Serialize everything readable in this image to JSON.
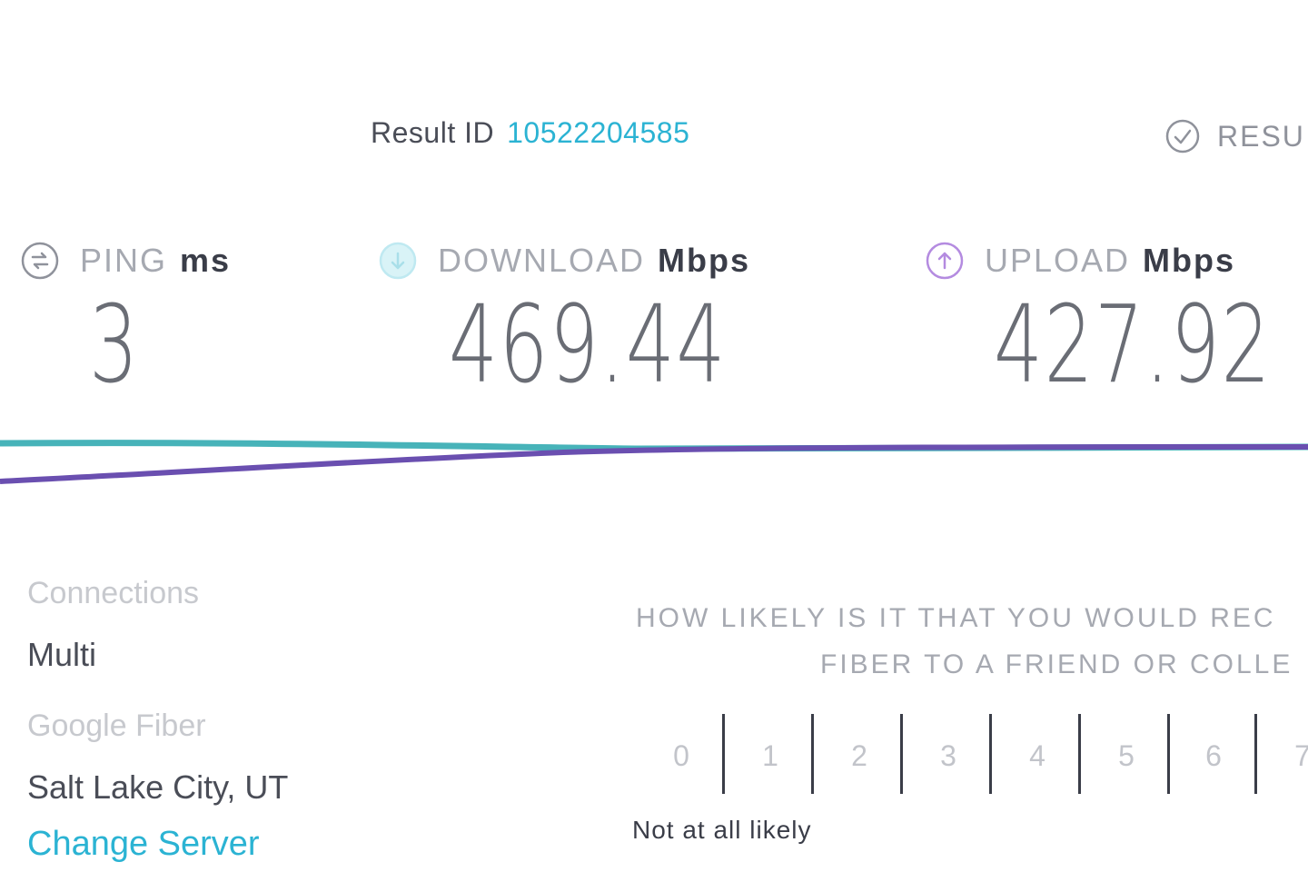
{
  "result": {
    "label": "Result ID",
    "id": "10522204585",
    "results_link": "RESU"
  },
  "metrics": {
    "ping": {
      "name": "PING",
      "unit": "ms",
      "value": "3"
    },
    "download": {
      "name": "DOWNLOAD",
      "unit": "Mbps",
      "value": "469.44"
    },
    "upload": {
      "name": "UPLOAD",
      "unit": "Mbps",
      "value": "427.92"
    }
  },
  "server": {
    "connections_label": "Connections",
    "connections_value": "Multi",
    "isp": "Google Fiber",
    "location": "Salt Lake City, UT",
    "change_server": "Change Server"
  },
  "survey": {
    "question_line1": "HOW LIKELY IS IT THAT YOU WOULD REC",
    "question_line2": "FIBER TO A FRIEND OR COLLE",
    "scale": [
      "0",
      "1",
      "2",
      "3",
      "4",
      "5",
      "6",
      "7"
    ],
    "low_label": "Not at all likely"
  },
  "colors": {
    "accent": "#2bb3d3",
    "download_line": "#47b3b9",
    "upload_line": "#6a4fb0",
    "text": "#3a3d48",
    "muted": "#a6a9b1"
  },
  "icons": {
    "results": "check-circle-icon",
    "ping": "ping-icon",
    "download": "download-icon",
    "upload": "upload-icon"
  }
}
